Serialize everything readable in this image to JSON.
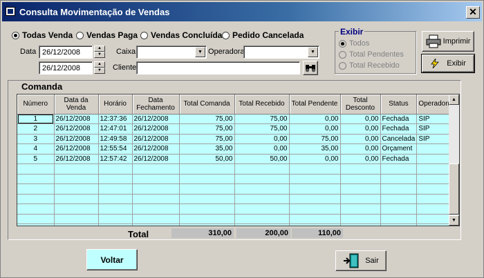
{
  "window": {
    "title": "Consulta Movimentação de Vendas",
    "close_glyph": "✕"
  },
  "filters": {
    "radios": [
      {
        "label": "Todas Venda",
        "checked": true
      },
      {
        "label": "Vendas Paga",
        "checked": false
      },
      {
        "label": "Vendas Concluída",
        "checked": false
      },
      {
        "label": "Pedido Cancelada",
        "checked": false
      }
    ],
    "data_label": "Data",
    "date_from": "26/12/2008",
    "date_to": "26/12/2008",
    "caixa_label": "Caixa",
    "caixa_value": "",
    "operadora_label": "Operadora",
    "operadora_value": "",
    "cliente_label": "Cliente",
    "cliente_value": ""
  },
  "exibir": {
    "title": "Exibir",
    "options": [
      {
        "label": "Todos",
        "checked": true
      },
      {
        "label": "Total Pendentes",
        "checked": false
      },
      {
        "label": "Total Recebido",
        "checked": false
      }
    ]
  },
  "buttons": {
    "imprimir": "Imprimir",
    "exibir": "Exibir",
    "voltar": "Voltar",
    "sair": "Sair"
  },
  "grid": {
    "title": "Comanda",
    "columns": [
      "Número",
      "Data da Venda",
      "Horário",
      "Data Fechamento",
      "Total Comanda",
      "Total Recebido",
      "Total Pendente",
      "Total Desconto",
      "Status",
      "Operador(a"
    ],
    "rows": [
      [
        "1",
        "26/12/2008",
        "12:37:36",
        "26/12/2008",
        "75,00",
        "75,00",
        "0,00",
        "0,00",
        "Fechada",
        "SIP"
      ],
      [
        "2",
        "26/12/2008",
        "12:47:01",
        "26/12/2008",
        "75,00",
        "75,00",
        "0,00",
        "0,00",
        "Fechada",
        "SIP"
      ],
      [
        "3",
        "26/12/2008",
        "12:49:58",
        "26/12/2008",
        "75,00",
        "0,00",
        "75,00",
        "0,00",
        "Cancelada",
        "SIP"
      ],
      [
        "4",
        "26/12/2008",
        "12:55:54",
        "26/12/2008",
        "35,00",
        "0,00",
        "35,00",
        "0,00",
        "Orçament",
        ""
      ],
      [
        "5",
        "26/12/2008",
        "12:57:42",
        "26/12/2008",
        "50,00",
        "50,00",
        "0,00",
        "0,00",
        "Fechada",
        ""
      ]
    ]
  },
  "totals": {
    "label": "Total",
    "comanda": "310,00",
    "recebido": "200,00",
    "pendente": "110,00"
  }
}
